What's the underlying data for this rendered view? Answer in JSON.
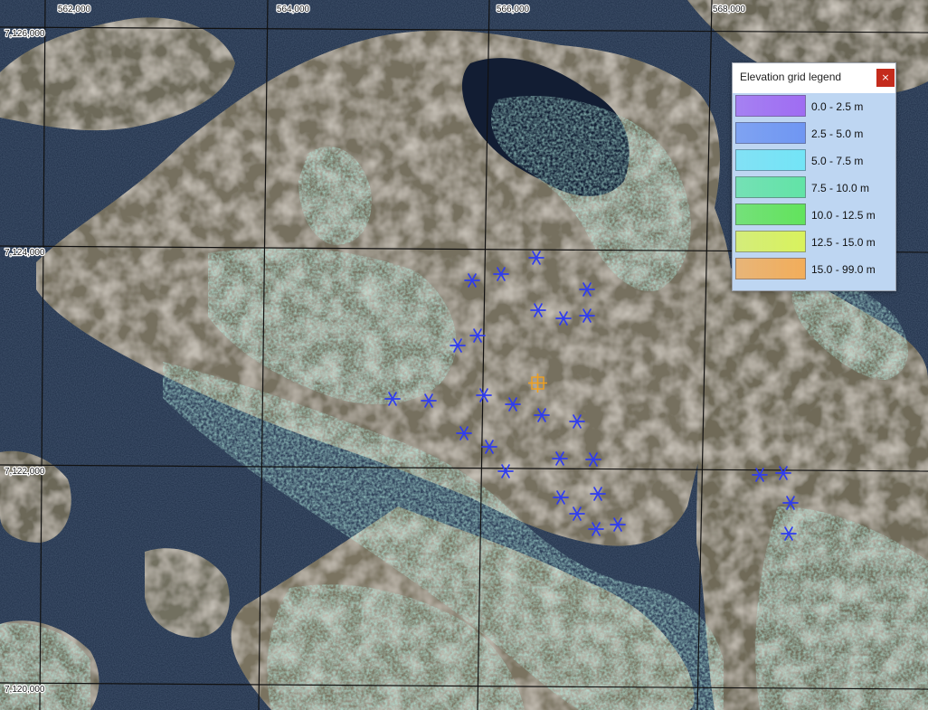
{
  "map": {
    "grid": {
      "easting_labels": [
        "562,000",
        "564,000",
        "566,000",
        "568,000"
      ],
      "northing_labels": [
        "7,126,000",
        "7,124,000",
        "7,122,000",
        "7,120,000"
      ]
    },
    "markers": {
      "symbol": "asterisk",
      "color": "#2f3cf0",
      "count": 31
    },
    "selected_marker": {
      "color": "#f0a01e"
    },
    "colors": {
      "water": "#1b2b44",
      "grid_lines": "#111111"
    }
  },
  "legend": {
    "title": "Elevation grid legend",
    "close_label": "×",
    "items": [
      {
        "label": "0.0 - 2.5 m",
        "color": "#9f6cf2"
      },
      {
        "label": "2.5 - 5.0 m",
        "color": "#6f96f2"
      },
      {
        "label": "5.0 - 7.5 m",
        "color": "#73e4f6"
      },
      {
        "label": "7.5 - 10.0 m",
        "color": "#62e3a6"
      },
      {
        "label": "10.0 - 12.5 m",
        "color": "#62e35c"
      },
      {
        "label": "12.5 - 15.0 m",
        "color": "#d9f25d"
      },
      {
        "label": "15.0 - 99.0 m",
        "color": "#f2ad5a"
      }
    ]
  }
}
